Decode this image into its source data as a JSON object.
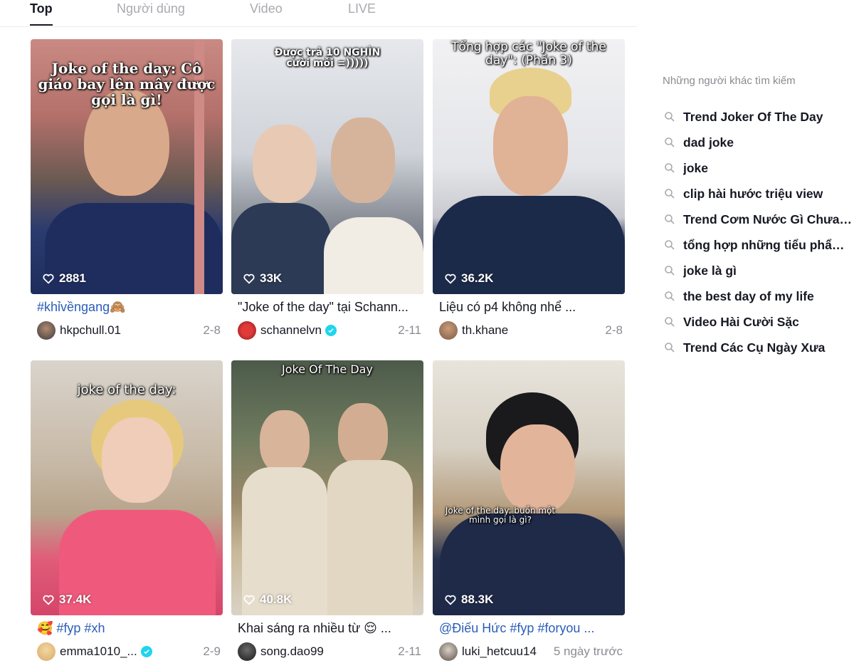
{
  "tabs": [
    {
      "label": "Top",
      "active": true
    },
    {
      "label": "Người dùng",
      "active": false
    },
    {
      "label": "Video",
      "active": false
    },
    {
      "label": "LIVE",
      "active": false
    }
  ],
  "videos": [
    {
      "overlay": "Joke of the day: Cô giáo bay lên mây được gọi là gì!",
      "likes": "2881",
      "caption": "#khỉvềngang🙈",
      "username": "hkpchull.01",
      "verified": false,
      "date": "2-8"
    },
    {
      "overlay": "Được trả 10 NGHÌN cười mỗi =)))))",
      "likes": "33K",
      "caption": "\"Joke of the day\" tại Schann...",
      "username": "schannelvn",
      "verified": true,
      "date": "2-11"
    },
    {
      "overlay": "Tổng hợp các \"Joke of the day\": (Phần 3)",
      "likes": "36.2K",
      "caption": "Liệu có p4 không nhể ...",
      "username": "th.khane",
      "verified": false,
      "date": "2-8"
    },
    {
      "overlay": "joke of the day:",
      "likes": "37.4K",
      "caption": "🥰 #fyp #xh",
      "username": "emma1010_...",
      "verified": true,
      "date": "2-9"
    },
    {
      "overlay": "Joke Of The Day",
      "likes": "40.8K",
      "caption": "Khai sáng ra nhiều từ 😌 ...",
      "username": "song.dao99",
      "verified": false,
      "date": "2-11"
    },
    {
      "overlay": "Joke of the day: buồn một mình gọi là gì?",
      "likes": "88.3K",
      "caption": "@Điếu Hức #fyp #foryou ...",
      "username": "luki_hetcuu14",
      "verified": false,
      "date": "5 ngày trước"
    }
  ],
  "sidebar": {
    "title": "Những người khác tìm kiếm",
    "items": [
      "Trend Joker Of The Day",
      "dad joke",
      "joke",
      "clip hài hước triệu view",
      "Trend Cơm Nước Gì Chưa N...",
      "tổng hợp những tiểu phẩm ...",
      "joke là gì",
      "the best day of my life",
      "Video Hài Cười Sặc",
      "Trend Các Cụ Ngày Xưa"
    ]
  },
  "colors": {
    "text": "#161823",
    "muted": "#8a8b91",
    "tab_inactive": "#a9aab0",
    "hashtag": "#2b5db9",
    "verified": "#20d5ec"
  },
  "icons": {
    "likes": "heart-outline-icon",
    "search_suggestion": "search-icon",
    "verified": "verified-check-icon"
  }
}
